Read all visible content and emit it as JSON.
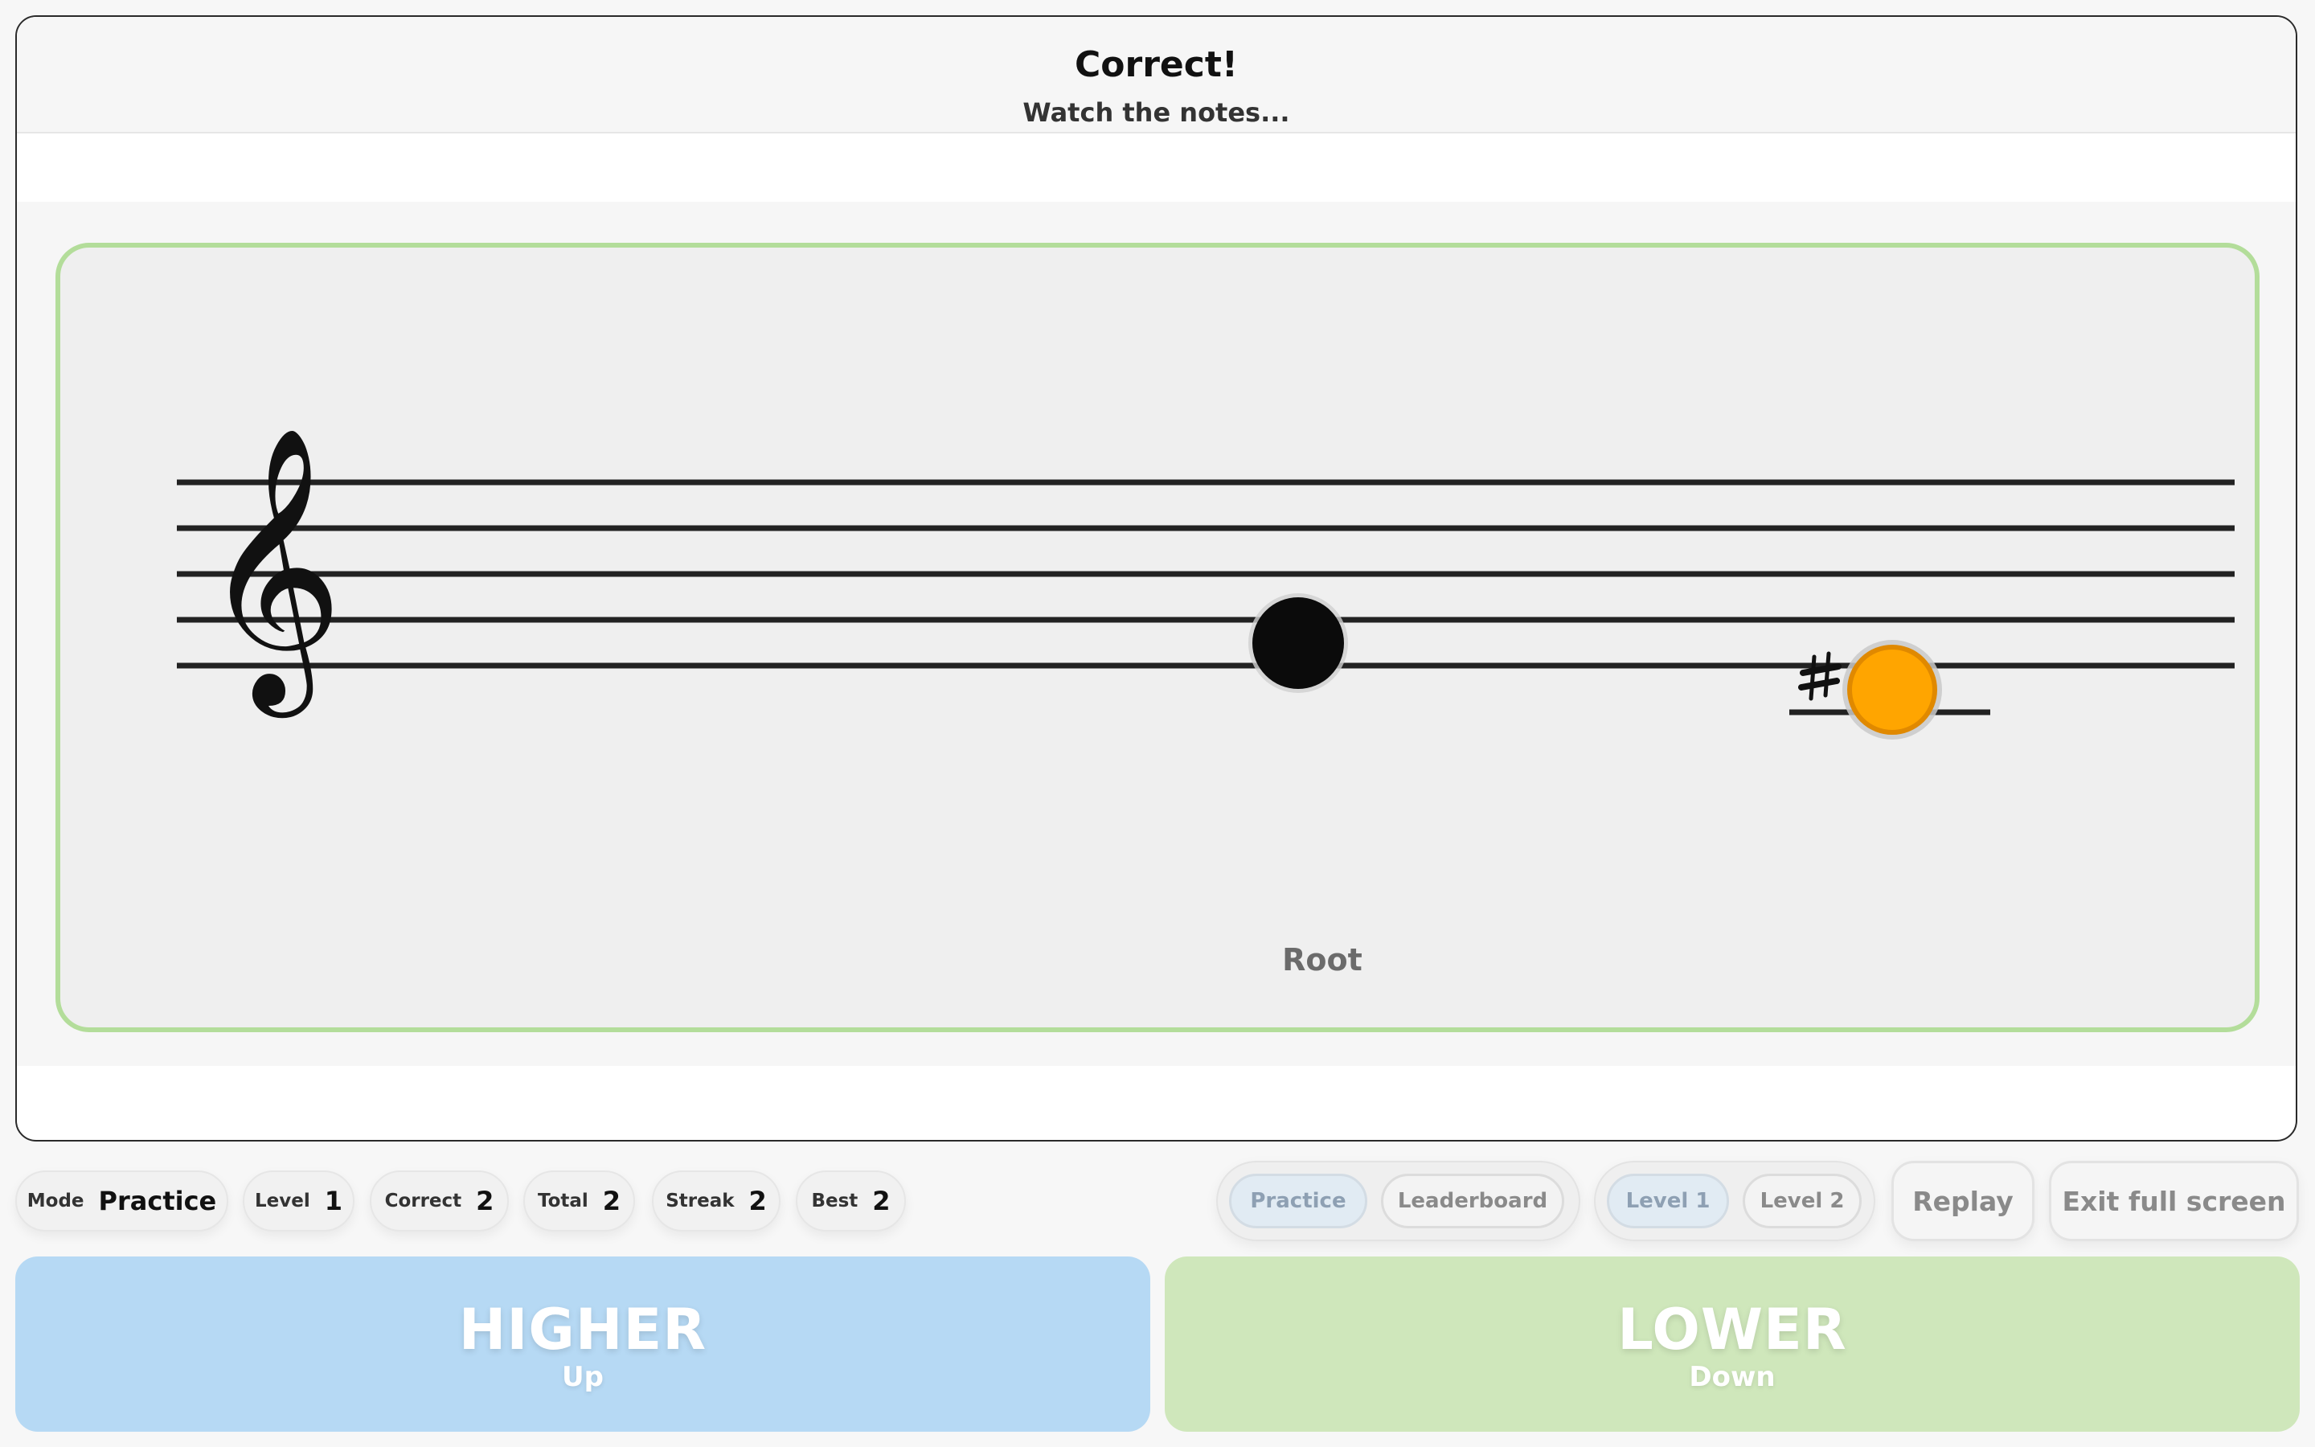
{
  "header": {
    "status_title": "Correct!",
    "status_subtitle": "Watch the notes..."
  },
  "staff": {
    "clef": "treble-clef",
    "root_label": "Root",
    "notes": [
      {
        "role": "root",
        "color": "#0b0b0b"
      },
      {
        "role": "played",
        "accidental": "♯",
        "color": "#ffa500"
      }
    ],
    "border_color": "#b3dd9a"
  },
  "stats": [
    {
      "label": "Mode",
      "value": "Practice"
    },
    {
      "label": "Level",
      "value": "1"
    },
    {
      "label": "Correct",
      "value": "2"
    },
    {
      "label": "Total",
      "value": "2"
    },
    {
      "label": "Streak",
      "value": "2"
    },
    {
      "label": "Best",
      "value": "2"
    }
  ],
  "mode_toggle": [
    {
      "label": "Practice",
      "active": true
    },
    {
      "label": "Leaderboard",
      "active": false
    }
  ],
  "level_toggle": [
    {
      "label": "Level 1",
      "active": true
    },
    {
      "label": "Level 2",
      "active": false
    }
  ],
  "actions": {
    "replay": "Replay",
    "exit_fullscreen": "Exit full screen"
  },
  "answers": {
    "higher": {
      "label": "HIGHER",
      "hint": "Up",
      "color": "#b6d9f4"
    },
    "lower": {
      "label": "LOWER",
      "hint": "Down",
      "color": "#cfe7bb"
    }
  }
}
